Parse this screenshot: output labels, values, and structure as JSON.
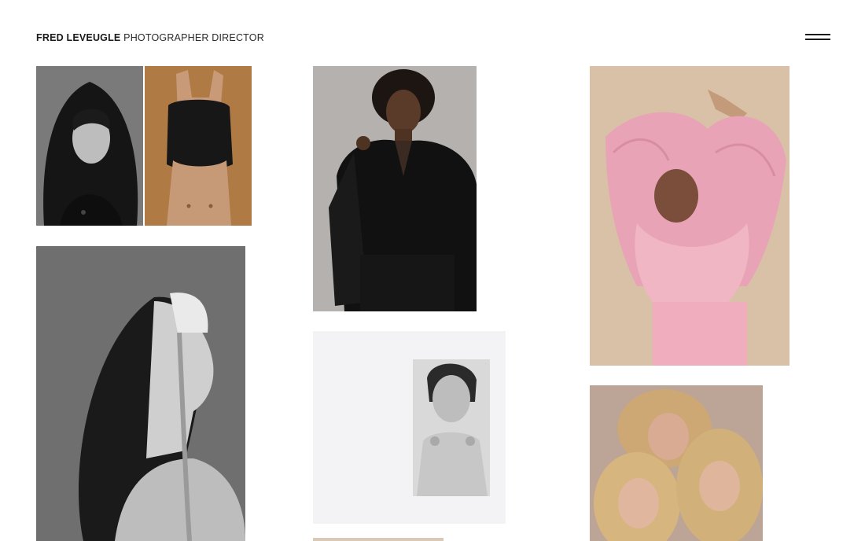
{
  "header": {
    "brand_name": "FRED LEVEUGLE",
    "brand_role": "PHOTOGRAPHER DIRECTOR",
    "menu_icon": "hamburger-menu-icon"
  },
  "gallery": {
    "photos": [
      {
        "id": "bw-coat-portrait"
      },
      {
        "id": "sweater-over-face"
      },
      {
        "id": "man-in-dark-suit"
      },
      {
        "id": "pink-ruffle-blouse"
      },
      {
        "id": "bw-profile-with-mask"
      },
      {
        "id": "bw-framed-portrait"
      },
      {
        "id": "three-blonde-women"
      },
      {
        "id": "partial-photo-bottom"
      }
    ]
  }
}
